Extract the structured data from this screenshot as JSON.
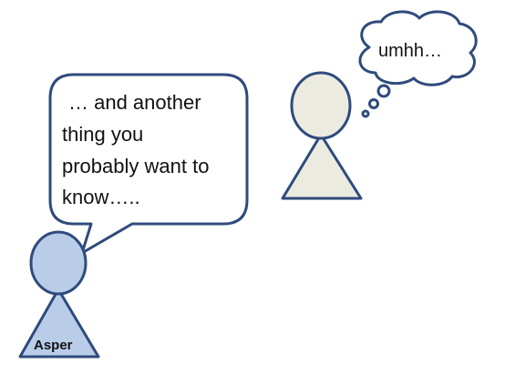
{
  "colors": {
    "outline": "#2f4b7c",
    "asper_fill": "#b9cde8",
    "other_fill": "#ecebe0",
    "bubble_fill": "#ffffff",
    "text": "#111111"
  },
  "speech_bubble": {
    "lines": [
      "… and another",
      "thing you",
      "probably want to",
      "know….."
    ]
  },
  "thought_bubble": {
    "text": "umhh…"
  },
  "asper": {
    "label": "Asper"
  }
}
